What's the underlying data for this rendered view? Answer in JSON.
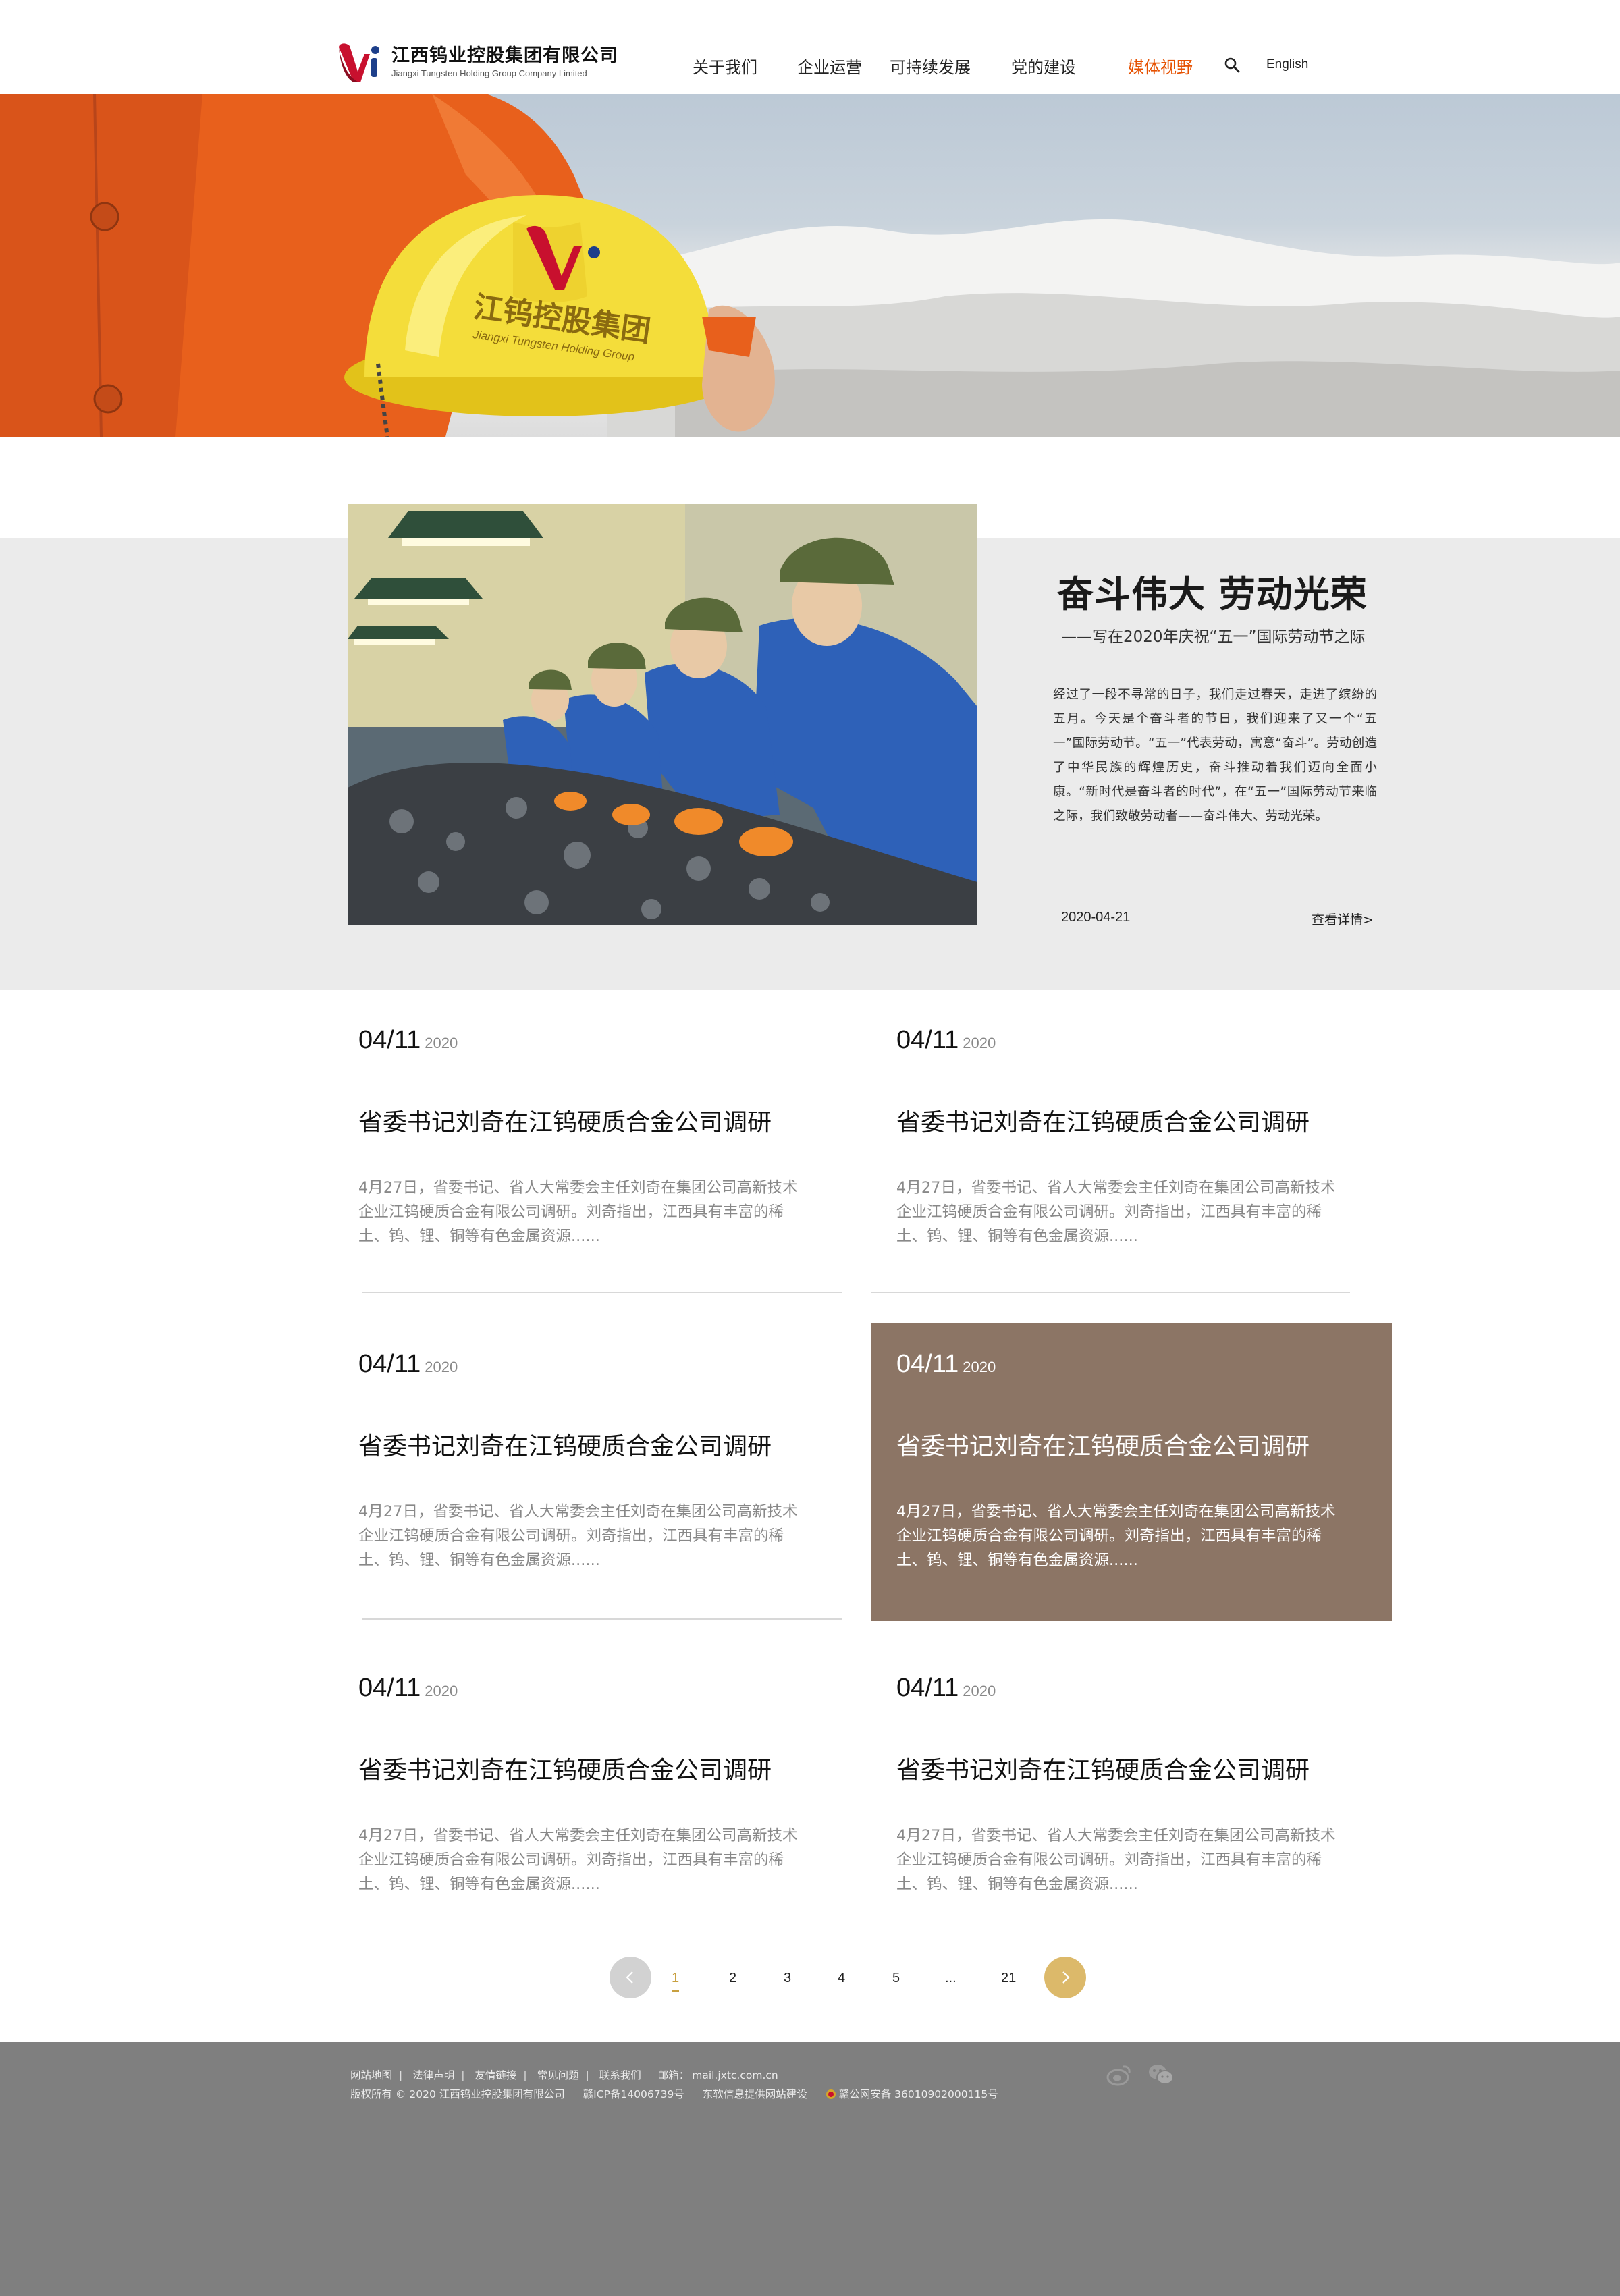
{
  "brand": {
    "name_cn": "江西钨业控股集团有限公司",
    "name_en": "Jiangxi Tungsten Holding Group Company Limited",
    "accent_red": "#c8102e",
    "accent_orange": "#e65100",
    "accent_gold": "#dcb96a"
  },
  "nav": {
    "items": [
      {
        "label": "关于我们"
      },
      {
        "label": "企业运营"
      },
      {
        "label": "可持续发展"
      },
      {
        "label": "党的建设"
      },
      {
        "label": "媒体视野",
        "active": true
      }
    ],
    "search_icon": "search-icon",
    "lang_label": "English"
  },
  "banner": {
    "helmet_text_cn": "江钨控股集团",
    "helmet_text_en": "Jiangxi Tungsten Holding Group"
  },
  "featured": {
    "title": "奋斗伟大 劳动光荣",
    "subtitle": "——写在2020年庆祝“五一”国际劳动节之际",
    "body": "经过了一段不寻常的日子，我们走过春天，走进了缤纷的五月。今天是个奋斗者的节日，我们迎来了又一个“五一”国际劳动节。“五一”代表劳动，寓意“奋斗”。劳动创造了中华民族的辉煌历史，奋斗推动着我们迈向全面小康。“新时代是奋斗者的时代”，在“五一”国际劳动节来临之际，我们致敬劳动者——奋斗伟大、劳动光荣。",
    "date": "2020-04-21",
    "more_label": "查看详情>"
  },
  "news": [
    {
      "date_md": "04/11",
      "year": "2020",
      "title": "省委书记刘奇在江钨硬质合金公司调研",
      "summary": "4月27日，省委书记、省人大常委会主任刘奇在集团公司高新技术企业江钨硬质合金有限公司调研。刘奇指出，江西具有丰富的稀土、钨、锂、铜等有色金属资源......"
    },
    {
      "date_md": "04/11",
      "year": "2020",
      "title": "省委书记刘奇在江钨硬质合金公司调研",
      "summary": "4月27日，省委书记、省人大常委会主任刘奇在集团公司高新技术企业江钨硬质合金有限公司调研。刘奇指出，江西具有丰富的稀土、钨、锂、铜等有色金属资源......"
    },
    {
      "date_md": "04/11",
      "year": "2020",
      "title": "省委书记刘奇在江钨硬质合金公司调研",
      "summary": "4月27日，省委书记、省人大常委会主任刘奇在集团公司高新技术企业江钨硬质合金有限公司调研。刘奇指出，江西具有丰富的稀土、钨、锂、铜等有色金属资源......"
    },
    {
      "date_md": "04/11",
      "year": "2020",
      "title": "省委书记刘奇在江钨硬质合金公司调研",
      "summary": "4月27日，省委书记、省人大常委会主任刘奇在集团公司高新技术企业江钨硬质合金有限公司调研。刘奇指出，江西具有丰富的稀土、钨、锂、铜等有色金属资源......",
      "highlighted": true
    },
    {
      "date_md": "04/11",
      "year": "2020",
      "title": "省委书记刘奇在江钨硬质合金公司调研",
      "summary": "4月27日，省委书记、省人大常委会主任刘奇在集团公司高新技术企业江钨硬质合金有限公司调研。刘奇指出，江西具有丰富的稀土、钨、锂、铜等有色金属资源......"
    },
    {
      "date_md": "04/11",
      "year": "2020",
      "title": "省委书记刘奇在江钨硬质合金公司调研",
      "summary": "4月27日，省委书记、省人大常委会主任刘奇在集团公司高新技术企业江钨硬质合金有限公司调研。刘奇指出，江西具有丰富的稀土、钨、锂、铜等有色金属资源......"
    }
  ],
  "pagination": {
    "pages": [
      "1",
      "2",
      "3",
      "4",
      "5",
      "...",
      "21"
    ],
    "current": "1",
    "prev_icon": "chevron-left-icon",
    "next_icon": "chevron-right-icon"
  },
  "footer": {
    "links": [
      "网站地图",
      "法律声明",
      "友情链接",
      "常见问题",
      "联系我们"
    ],
    "mail_label": "邮箱：",
    "mail": "mail.jxtc.com.cn",
    "copyright": "版权所有 © 2020 江西钨业控股集团有限公司",
    "icp": "赣ICP备14006739号",
    "builder": "东软信息提供网站建设",
    "police": "赣公网安备 36010902000115号",
    "social_icons": [
      "weibo-icon",
      "wechat-icon"
    ]
  }
}
